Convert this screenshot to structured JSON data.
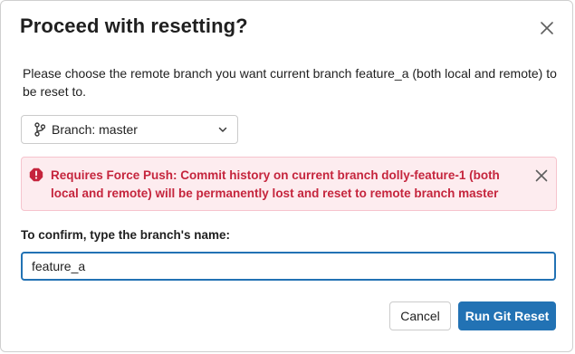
{
  "dialog": {
    "title": "Proceed with resetting?",
    "description": "Please choose the remote branch you want current branch feature_a (both local and remote) to be reset to."
  },
  "branch_select": {
    "label": "Branch: master",
    "icon": "git-branch-icon"
  },
  "alert": {
    "icon": "error-icon",
    "message": "Requires Force Push: Commit history on current branch dolly-feature-1 (both local and remote) will be permanently lost and reset to remote branch master",
    "color": "#c5253d",
    "background": "#fdecef"
  },
  "confirm": {
    "label": "To confirm, type the branch's name:",
    "value": "feature_a"
  },
  "buttons": {
    "cancel": "Cancel",
    "primary": "Run Git Reset"
  },
  "colors": {
    "accent": "#2272b4"
  }
}
